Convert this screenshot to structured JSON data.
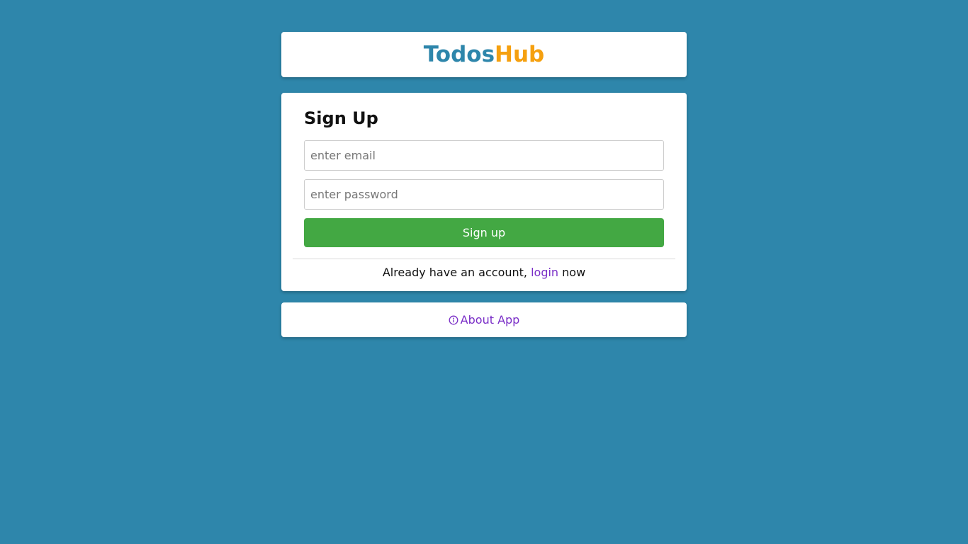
{
  "brand": {
    "part1": "Todos",
    "part2": "Hub"
  },
  "signup": {
    "title": "Sign Up",
    "email_placeholder": "enter email",
    "password_placeholder": "enter password",
    "button_label": "Sign up",
    "prompt_before": "Already have an account, ",
    "login_link": "login",
    "prompt_after": " now"
  },
  "about": {
    "icon": "info-icon",
    "label": "About App"
  },
  "colors": {
    "background": "#2e86ab",
    "brand_primary": "#2e86ab",
    "brand_accent": "#f5a00f",
    "button": "#43a843",
    "link": "#7a2ec7"
  }
}
